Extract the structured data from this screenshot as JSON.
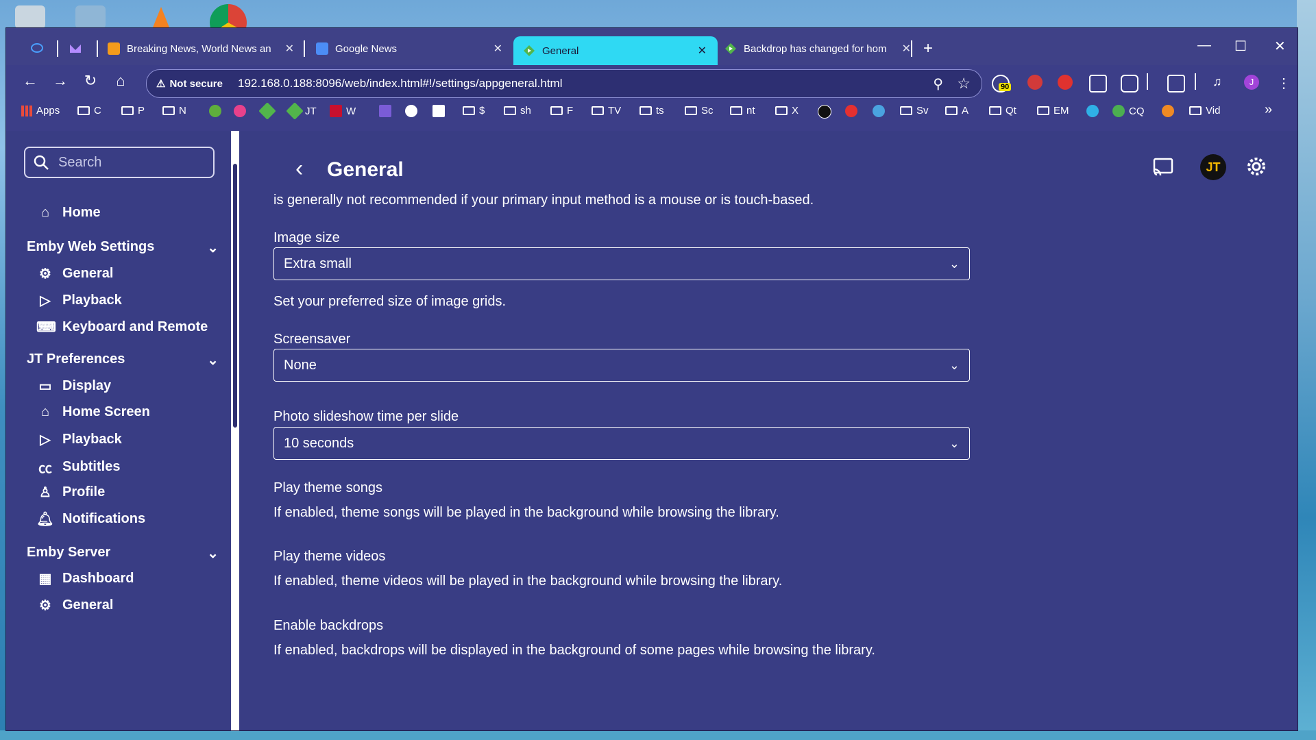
{
  "browser": {
    "tabs": [
      {
        "title": "Breaking News, World News and"
      },
      {
        "title": "Google News"
      },
      {
        "title": "General"
      },
      {
        "title": "Backdrop has changed for hom"
      }
    ],
    "new_tab": "+",
    "omnibox": {
      "security": "Not secure",
      "url": "192.168.0.188:8096/web/index.html#!/settings/appgeneral.html"
    },
    "extension_badge": "90",
    "profile_initial": "J",
    "bookmarks": [
      "Apps",
      "C",
      "P",
      "N",
      "JT",
      "W",
      "$",
      "sh",
      "F",
      "TV",
      "ts",
      "Sc",
      "nt",
      "X",
      "Sv",
      "A",
      "Qt",
      "EM",
      "CQ",
      "Vid"
    ],
    "overflow": "»"
  },
  "sidebar": {
    "search_placeholder": "Search",
    "home": "Home",
    "sections": [
      {
        "title": "Emby Web Settings",
        "items": [
          "General",
          "Playback",
          "Keyboard and Remote"
        ]
      },
      {
        "title": "JT Preferences",
        "items": [
          "Display",
          "Home Screen",
          "Playback",
          "Subtitles",
          "Profile",
          "Notifications"
        ]
      },
      {
        "title": "Emby Server",
        "items": [
          "Dashboard",
          "General"
        ]
      }
    ]
  },
  "main": {
    "title": "General",
    "avatar": "JT",
    "intro_text": "is generally not recommended if your primary input method is a mouse or is touch-based.",
    "image_size": {
      "label": "Image size",
      "value": "Extra small",
      "help": "Set your preferred size of image grids."
    },
    "screensaver": {
      "label": "Screensaver",
      "value": "None"
    },
    "slideshow": {
      "label": "Photo slideshow time per slide",
      "value": "10 seconds"
    },
    "theme_songs": {
      "label": "Play theme songs",
      "help": "If enabled, theme songs will be played in the background while browsing the library."
    },
    "theme_videos": {
      "label": "Play theme videos",
      "help": "If enabled, theme videos will be played in the background while browsing the library."
    },
    "backdrops": {
      "label": "Enable backdrops",
      "help": "If enabled, backdrops will be displayed in the background of some pages while browsing the library."
    }
  }
}
